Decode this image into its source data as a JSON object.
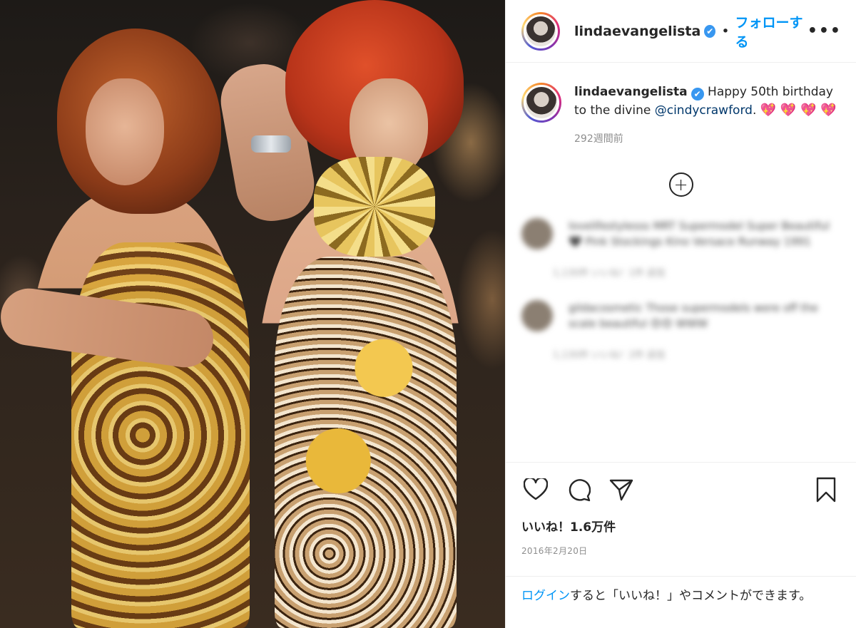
{
  "post": {
    "username": "lindaevangelista",
    "verified_mark": "✔",
    "separator": "•",
    "follow_label": "フォローする",
    "more_label": "•••"
  },
  "caption": {
    "username": "lindaevangelista",
    "text_before_mention": " Happy 50th birthday to the divine ",
    "mention": "@cindycrawford",
    "text_after_mention": ". ",
    "emoji": "💖 💖 💖 💖",
    "time_ago": "292週間前"
  },
  "load_more": {
    "plus_icon": "+"
  },
  "comments": [
    {
      "text": "lovelifestylesss MRT Supermodel Super Beautiful 🖤 Pink Stockings Kino Versace Runway 1991",
      "meta": "1,130件  いいね！1件  返信"
    },
    {
      "text": "gildacosmetic Those supermodels were off the scale beautiful 😍😍 WWW",
      "meta": "1,130件  いいね！2件  返信"
    }
  ],
  "actions": {
    "like_icon": "heart-icon",
    "comment_icon": "comment-icon",
    "share_icon": "share-icon",
    "save_icon": "bookmark-icon",
    "likes_text": "いいね！1.6万件",
    "date": "2016年2月20日"
  },
  "login": {
    "link": "ログイン",
    "rest": "すると「いいね！」やコメントができます。"
  },
  "colors": {
    "link_blue": "#0095f6",
    "mention_navy": "#00376b",
    "muted_gray": "#8e8e8e"
  }
}
